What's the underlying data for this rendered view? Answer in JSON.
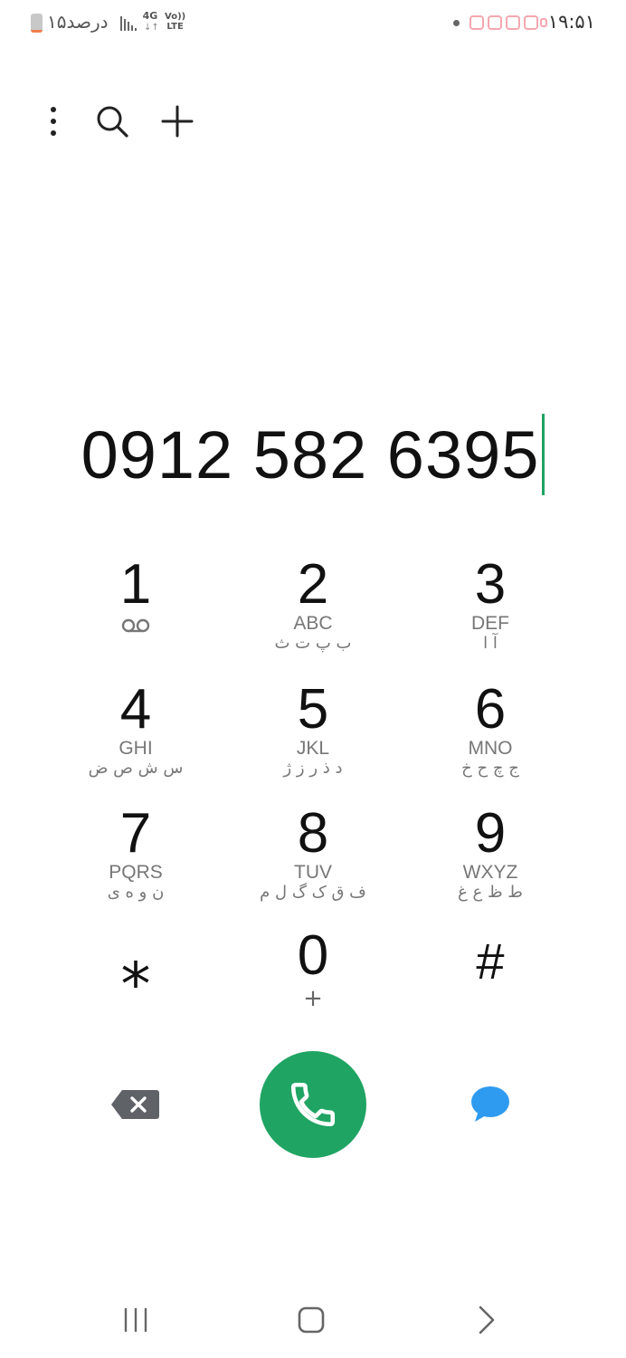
{
  "status_bar": {
    "battery_text": "۱۵درصد",
    "battery_level_percent": 15,
    "network_type": "4G",
    "network_arrows": "↓↑",
    "volte_top": "Vo))",
    "volte_bottom": "LTE",
    "time": "۱۹:۵۱"
  },
  "dialer": {
    "number": "0912 582 6395"
  },
  "keypad": [
    {
      "digit": "1",
      "letters": "",
      "persian": "",
      "sub": "voicemail"
    },
    {
      "digit": "2",
      "letters": "ABC",
      "persian": "ب پ ت ث",
      "sub": ""
    },
    {
      "digit": "3",
      "letters": "DEF",
      "persian": "آ ا",
      "sub": ""
    },
    {
      "digit": "4",
      "letters": "GHI",
      "persian": "س ش ص ض",
      "sub": ""
    },
    {
      "digit": "5",
      "letters": "JKL",
      "persian": "د ذ ر ز ژ",
      "sub": ""
    },
    {
      "digit": "6",
      "letters": "MNO",
      "persian": "ج چ ح خ",
      "sub": ""
    },
    {
      "digit": "7",
      "letters": "PQRS",
      "persian": "ن و ه ی",
      "sub": ""
    },
    {
      "digit": "8",
      "letters": "TUV",
      "persian": "ف ق ک گ ل م",
      "sub": ""
    },
    {
      "digit": "9",
      "letters": "WXYZ",
      "persian": "ط ظ ع غ",
      "sub": ""
    },
    {
      "digit": "⁎",
      "letters": "",
      "persian": "",
      "sub": ""
    },
    {
      "digit": "0",
      "letters": "",
      "persian": "",
      "sub": "+"
    },
    {
      "digit": "#",
      "letters": "",
      "persian": "",
      "sub": ""
    }
  ],
  "colors": {
    "call_green": "#1fa463",
    "message_blue": "#2e9bf0",
    "backspace_gray": "#5f6368",
    "cursor_green": "#1fa463"
  },
  "icons": {
    "more": "more-vertical-icon",
    "search": "search-icon",
    "add": "plus-icon",
    "backspace": "backspace-icon",
    "call": "phone-icon",
    "message": "message-icon",
    "nav_recents": "recents-icon",
    "nav_home": "home-icon",
    "nav_back": "back-icon"
  }
}
